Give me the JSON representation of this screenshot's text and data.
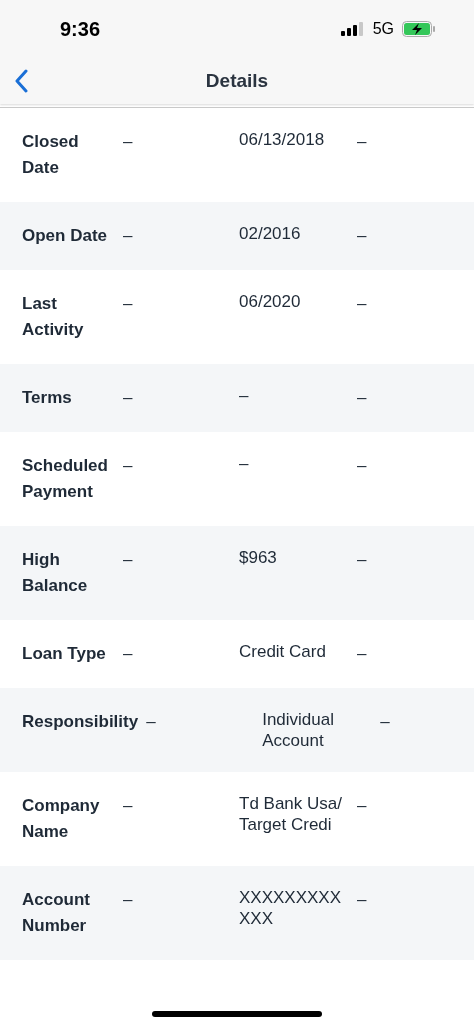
{
  "status_bar": {
    "time": "9:36",
    "network": "5G"
  },
  "nav": {
    "title": "Details"
  },
  "rows": [
    {
      "label": "Closed Date",
      "col_2": "–",
      "col_3": "06/13/2018",
      "col_4": "–"
    },
    {
      "label": "Open Date",
      "col_2": "–",
      "col_3": "02/2016",
      "col_4": "–"
    },
    {
      "label": "Last Activity",
      "col_2": "–",
      "col_3": "06/2020",
      "col_4": "–"
    },
    {
      "label": "Terms",
      "col_2": "–",
      "col_3": "–",
      "col_4": "–"
    },
    {
      "label": "Scheduled Payment",
      "col_2": "–",
      "col_3": "–",
      "col_4": "–"
    },
    {
      "label": "High Balance",
      "col_2": "–",
      "col_3": "$963",
      "col_4": "–"
    },
    {
      "label": "Loan Type",
      "col_2": "–",
      "col_3": "Credit Card",
      "col_4": "–"
    },
    {
      "label": "Responsibility",
      "col_2": "–",
      "col_3": "Individual Account",
      "col_4": "–"
    },
    {
      "label": "Company Name",
      "col_2": "–",
      "col_3": "Td Bank Usa/ Target Credi",
      "col_4": "–"
    },
    {
      "label": "Account Number",
      "col_2": "–",
      "col_3": "XXXXXXXXXXXX",
      "col_4": "–"
    }
  ]
}
